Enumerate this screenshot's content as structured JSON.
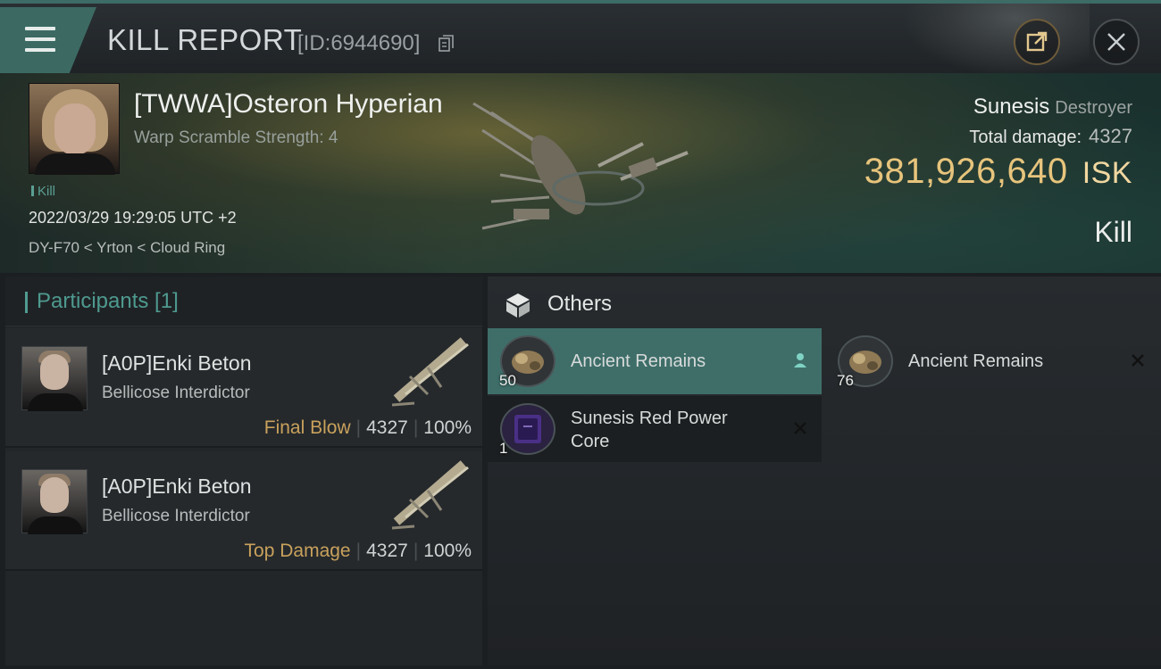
{
  "header": {
    "title": "KILL REPORT",
    "report_id": "[ID:6944690]"
  },
  "victim": {
    "name": "[TWWA]Osteron Hyperian",
    "warp_scramble": "Warp Scramble Strength: 4",
    "kill_tag": "Kill",
    "timestamp": "2022/03/29 19:29:05 UTC +2",
    "location": "DY-F70 < Yrton < Cloud Ring",
    "ship_name": "Sunesis",
    "ship_class": "Destroyer",
    "total_damage_label": "Total damage:",
    "total_damage": "4327",
    "isk_value": "381,926,640",
    "isk_unit": "ISK",
    "result": "Kill"
  },
  "participants": {
    "label": "Participants [1]",
    "rows": [
      {
        "name": "[A0P]Enki Beton",
        "ship": "Bellicose Interdictor",
        "tag": "Final Blow",
        "damage": "4327",
        "percent": "100%"
      },
      {
        "name": "[A0P]Enki Beton",
        "ship": "Bellicose Interdictor",
        "tag": "Top Damage",
        "damage": "4327",
        "percent": "100%"
      }
    ]
  },
  "others": {
    "label": "Others",
    "items": [
      {
        "name": "Ancient Remains",
        "qty": "50",
        "selected": true,
        "mark": "person-icon"
      },
      {
        "name": "Ancient Remains",
        "qty": "76",
        "selected": false,
        "mark": "close-icon"
      },
      {
        "name": "Sunesis Red Power Core",
        "qty": "1",
        "selected": false,
        "mark": "close-icon"
      }
    ]
  },
  "colors": {
    "accent_teal": "#3f6e69",
    "isk_gold": "#e7c47c",
    "tag_gold": "#c9a15c"
  }
}
